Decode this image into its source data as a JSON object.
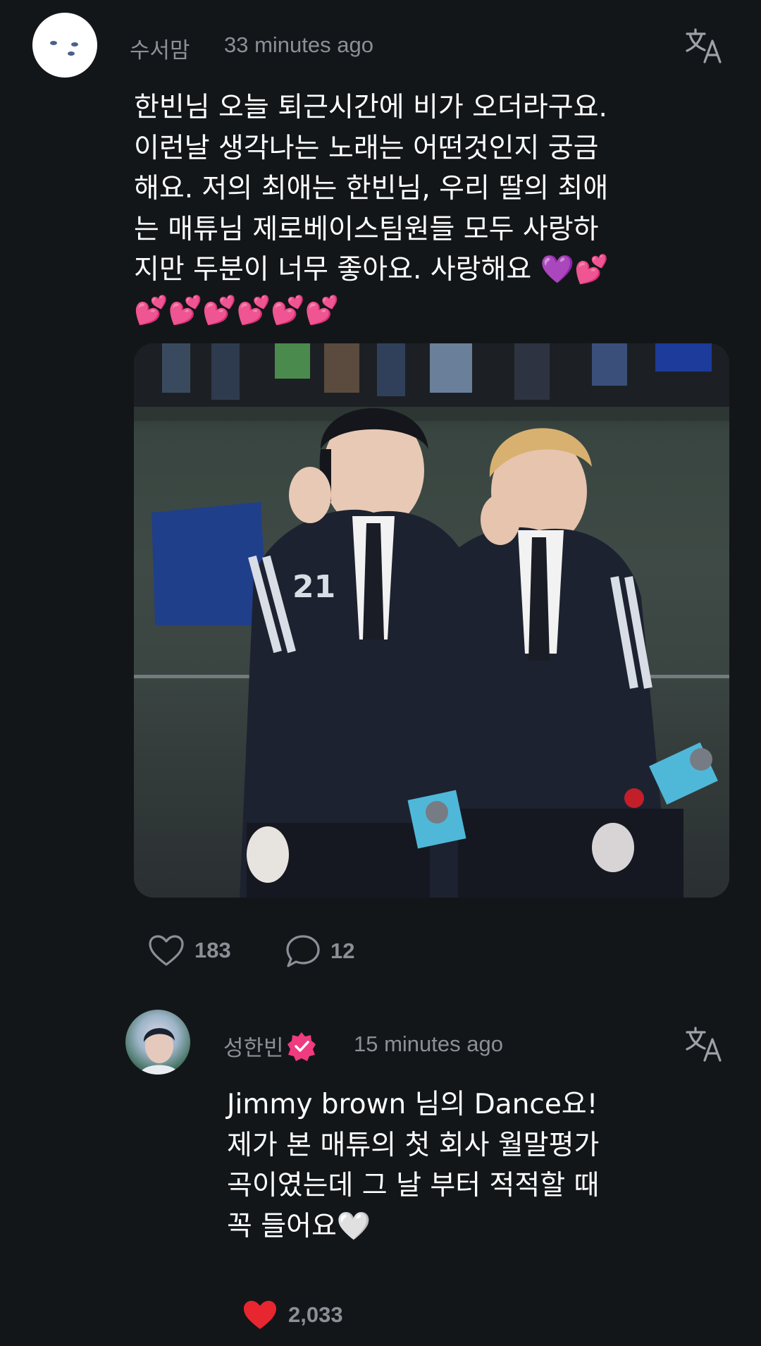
{
  "post": {
    "author": "수서맘",
    "time": "33 minutes ago",
    "body": "한빈님 오늘 퇴근시간에 비가 오더라구요.\n이런날 생각나는 노래는 어떤것인지 궁금\n해요. 저의 최애는 한빈님, 우리 딸의 최애\n는 매튜님 제로베이스팀원들 모두 사랑하\n지만 두분이 너무 좋아요. 사랑해요 💜💕\n💕💕💕💕💕💕",
    "likes": "183",
    "comments": "12",
    "photo_jersey_number": "21"
  },
  "reply": {
    "author": "성한빈",
    "time": "15 minutes ago",
    "body": "Jimmy brown 님의 Dance요!\n제가 본 매튜의 첫 회사 월말평가\n곡이였는데 그 날 부터 적적할 때\n꼭 들어요🤍",
    "likes": "2,033"
  },
  "icons": {
    "translate": "translate-icon",
    "like": "heart-outline-icon",
    "liked": "heart-filled-icon",
    "comment": "speech-bubble-icon",
    "verified": "verified-badge-icon"
  },
  "colors": {
    "background": "#131619",
    "muted_text": "#8c9096",
    "verified_badge": "#ef3b7f",
    "liked_heart": "#e8262f"
  }
}
